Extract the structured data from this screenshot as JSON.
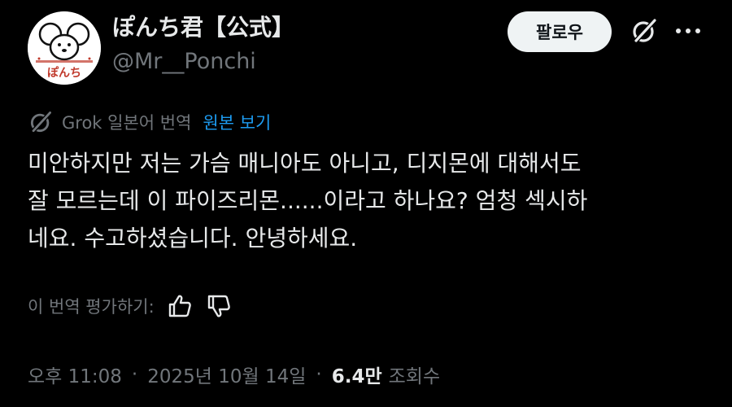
{
  "author": {
    "display_name": "ぽんち君【公式】",
    "handle": "@Mr__Ponchi",
    "avatar_text": "ぽんち",
    "avatar_icon": "mouse-logo-icon"
  },
  "header": {
    "follow_label": "팔로우",
    "grok_icon": "grok-icon",
    "more_icon": "more-horizontal-icon"
  },
  "translation": {
    "icon": "grok-icon",
    "label": "Grok 일본어 번역",
    "show_original_label": "원본 보기"
  },
  "tweet": {
    "lines": [
      "미안하지만 저는 가슴 매니아도 아니고, 디지몬에 대해서도",
      "잘 모르는데 이 파이즈리몬......이라고 하나요? 엄청 섹시하",
      "네요. 수고하셨습니다. 안녕하세요."
    ]
  },
  "rating": {
    "label": "이 번역 평가하기:",
    "thumbs_up_icon": "thumbs-up-icon",
    "thumbs_down_icon": "thumbs-down-icon"
  },
  "meta": {
    "time": "오후 11:08",
    "separator": "·",
    "date": "2025년 10월 14일",
    "views_count": "6.4만",
    "views_label": "조회수"
  },
  "colors": {
    "background": "#000000",
    "text_primary": "#e7e9ea",
    "text_secondary": "#71767b",
    "link_blue": "#1d9bf0",
    "follow_button_bg": "#eff3f4"
  }
}
